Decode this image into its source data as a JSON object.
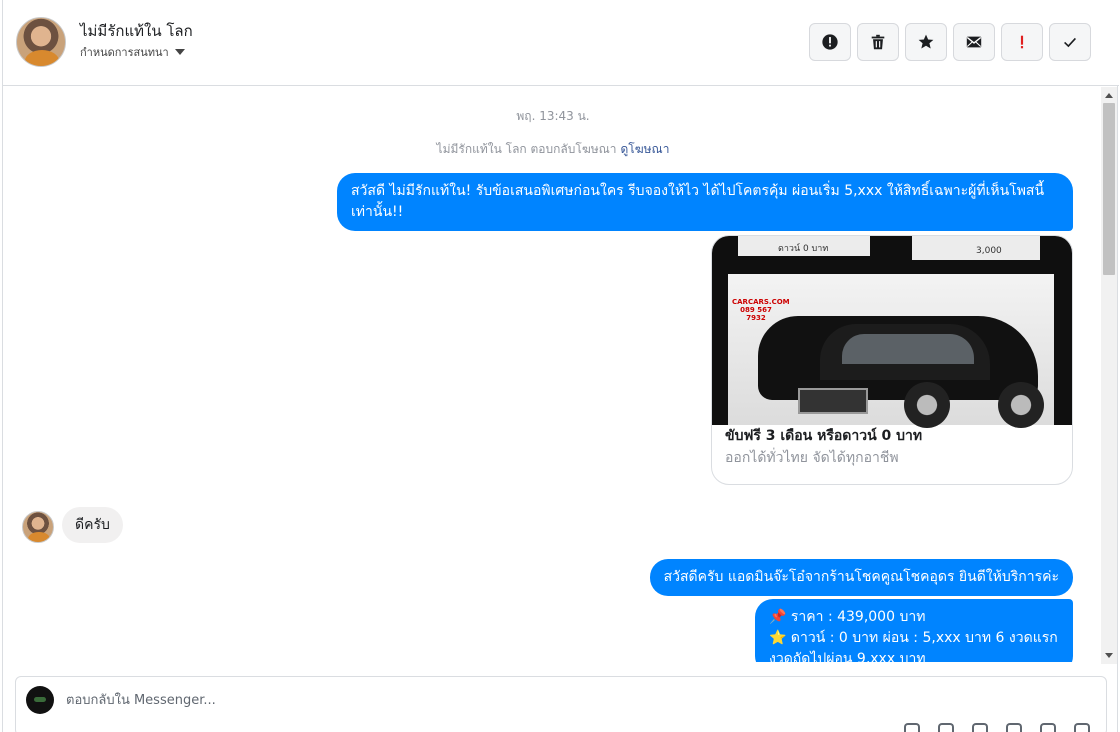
{
  "header": {
    "contact_name": "ไม่มีรักแท้ใน โลก",
    "assign_label": "กำหนดการสนทนา"
  },
  "toolbar": {
    "items": [
      {
        "name": "mark-spam",
        "icon": "alert-circle-icon"
      },
      {
        "name": "delete",
        "icon": "trash-icon"
      },
      {
        "name": "star",
        "icon": "star-icon"
      },
      {
        "name": "mark-unread",
        "icon": "envelope-icon"
      },
      {
        "name": "follow-up",
        "icon": "exclamation-icon",
        "color": "#e02020"
      },
      {
        "name": "mark-done",
        "icon": "check-icon"
      }
    ]
  },
  "thread": {
    "timestamp": "พฤ. 13:43 น.",
    "ad_note": "ไม่มีรักแท้ใน โลก ตอบกลับโฆษณา",
    "ad_link": "ดูโฆษณา",
    "outgoing_1": "สวัสดี ไม่มีรักแท้ใน! รับข้อเสนอพิเศษก่อนใคร รีบจองให้ไว ได้ไปโคตรคุ้ม ผ่อนเริ่ม 5,xxx ให้สิทธิ์เฉพาะผู้ที่เห็นโพสนี้เท่านั้น!!",
    "card": {
      "top_left_text": "ดาวน์ 0 บาท",
      "top_right_text": "3,000",
      "logo_text": "CARCARS.COM 089 567 7932",
      "title": "ขับฟรี 3 เดือน หรือดาวน์ 0 บาท",
      "subtitle": "ออกได้ทั่วไทย จัดได้ทุกอาชีพ"
    },
    "incoming_1": "ดีครับ",
    "outgoing_2": "สวัสดีครับ แอดมินจ๊ะโอ๋จากร้านโชคคูณโชคอุดร ยินดีให้บริการค่ะ",
    "outgoing_3_line1": "📌 ราคา : 439,000 บาท",
    "outgoing_3_line2": "⭐ ดาวน์ : 0 บาท ผ่อน : 5,xxx บาท 6 งวดแรก",
    "outgoing_3_line3": "งวดถัดไปผ่อน 9,xxx บาท"
  },
  "composer": {
    "placeholder": "ตอบกลับใน Messenger..."
  },
  "colors": {
    "accent": "#0084ff",
    "incoming_bubble": "#f1f0f0",
    "muted_text": "#90949c",
    "link": "#385898"
  }
}
